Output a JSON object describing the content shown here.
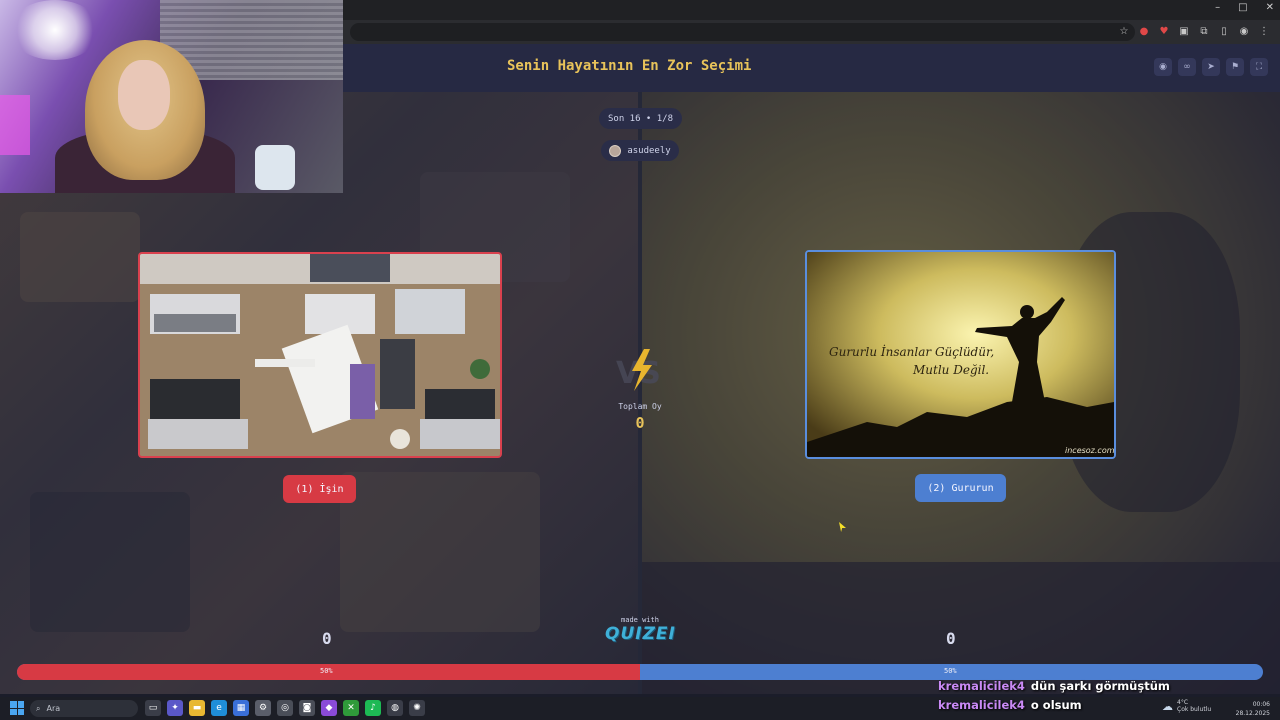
{
  "window": {
    "controls": [
      "–",
      "□",
      "✕"
    ]
  },
  "app": {
    "title": "Senin Hayatının En Zor Seçimi"
  },
  "header_icons": [
    "eye-icon",
    "link-icon",
    "send-icon",
    "flag-icon",
    "fullscreen-icon"
  ],
  "round": {
    "label": "Son 16 • 1/8"
  },
  "user": {
    "name": "asudeely"
  },
  "left_choice": {
    "label": "(1) İşin",
    "score": "0",
    "percent": "50%",
    "percent_value": 50
  },
  "right_choice": {
    "label": "(2) Gururun",
    "score": "0",
    "percent": "50%",
    "percent_value": 50,
    "image_caption": "Gururlu İnsanlar Güçlüdür, Mutlu Değil.",
    "image_credit": "incesoz.com"
  },
  "total": {
    "label": "Toplam Oy",
    "value": "0"
  },
  "brand": {
    "made_with": "made with",
    "name": "QUIZEI"
  },
  "taskbar": {
    "search_placeholder": "Ara",
    "weather_temp": "4°C",
    "weather_desc": "Çok bulutlu",
    "time": "00:06",
    "date": "28.12.2025"
  },
  "chat": [
    {
      "user": "kremalicilek4",
      "message": "dün şarkı görmüştüm"
    },
    {
      "user": "kremalicilek4",
      "message": "o olsum"
    }
  ],
  "colors": {
    "left": "#d73a44",
    "right": "#4d7fd1",
    "accent": "#e8c35a",
    "header": "#262943"
  }
}
